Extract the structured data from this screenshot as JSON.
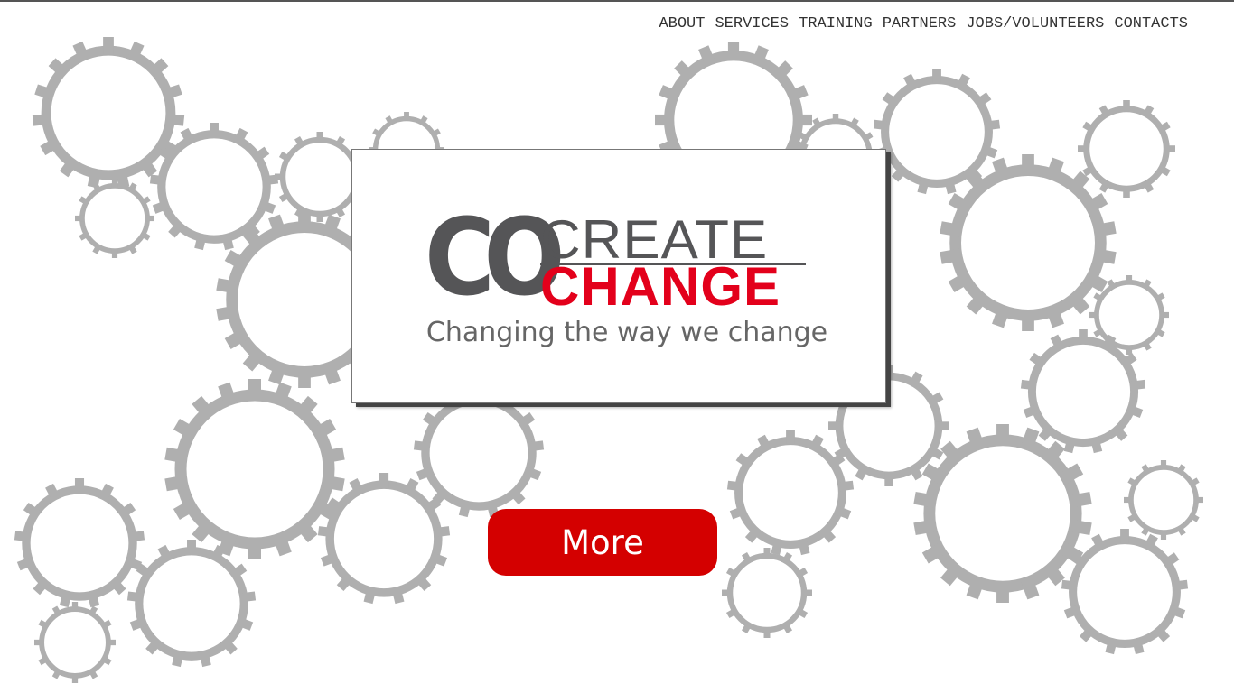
{
  "nav": {
    "items": [
      {
        "label": "ABOUT"
      },
      {
        "label": "SERVICES"
      },
      {
        "label": "TRAINING"
      },
      {
        "label": "PARTNERS"
      },
      {
        "label": "JOBS/VOLUNTEERS"
      },
      {
        "label": "CONTACTS"
      }
    ]
  },
  "logo": {
    "co": "CO",
    "create": "CREATE",
    "change": "CHANGE"
  },
  "tagline": "Changing the way we change",
  "cta": {
    "more_label": "More"
  },
  "colors": {
    "gear": "#afafaf",
    "brand_red": "#e3001b",
    "button_red": "#d40000",
    "logo_gray": "#555557"
  },
  "background": {
    "icon": "gear-icon"
  }
}
